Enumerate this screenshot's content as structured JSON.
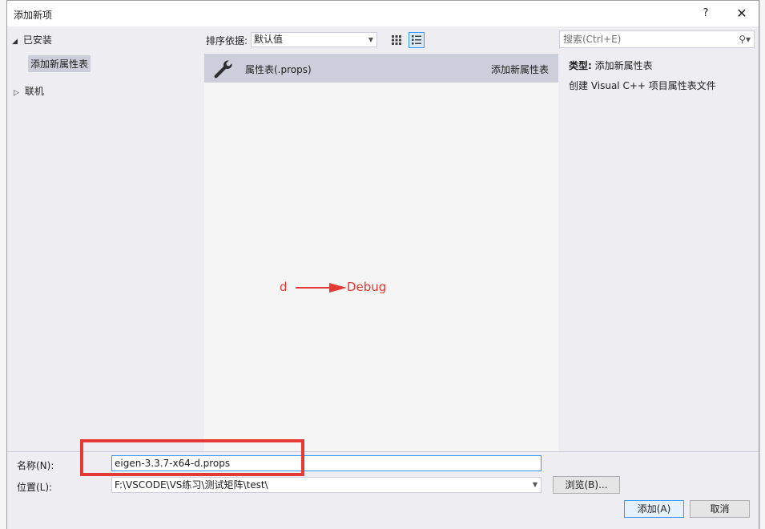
{
  "window": {
    "title": "添加新项",
    "help": "?",
    "close": "✕"
  },
  "tree": {
    "installed": "已安装",
    "selected_item": "添加新属性表",
    "online": "联机"
  },
  "toolbar": {
    "sort_label": "排序依据:",
    "sort_value": "默认值"
  },
  "list": {
    "items": [
      {
        "name": "属性表(.props)",
        "type": "添加新属性表",
        "icon": "wrench-icon"
      }
    ]
  },
  "annotation": {
    "left": "d",
    "right": "Debug",
    "color": "#e53935"
  },
  "search": {
    "placeholder": "搜索(Ctrl+E)"
  },
  "details": {
    "type_label": "类型:",
    "type_value": "添加新属性表",
    "description": "创建 Visual C++ 项目属性表文件"
  },
  "form": {
    "name_label": "名称(N):",
    "name_value": "eigen-3.3.7-x64-d.props",
    "location_label": "位置(L):",
    "location_value": "F:\\VSCODE\\VS练习\\测试矩阵\\test\\",
    "browse_label": "浏览(B)...",
    "add_label": "添加(A)",
    "cancel_label": "取消"
  }
}
